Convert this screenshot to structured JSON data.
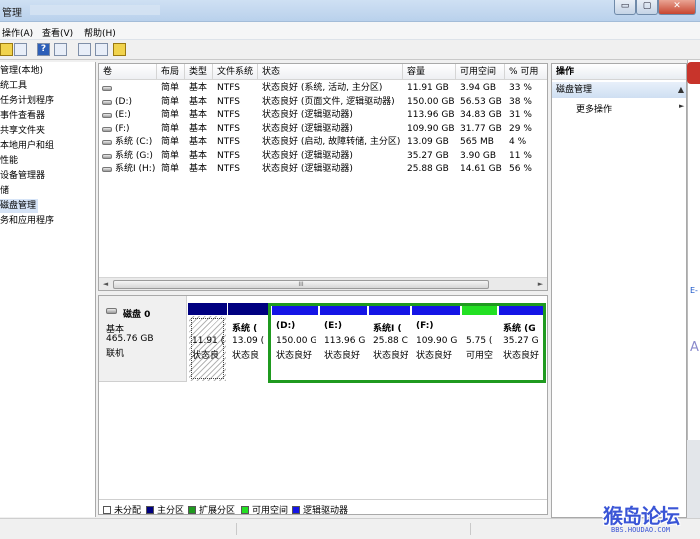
{
  "window": {
    "title": "管理",
    "controls": {
      "minimize": "▭",
      "maximize": "▢",
      "close": "✕"
    }
  },
  "menu": {
    "items": [
      "操作(A)",
      "查看(V)",
      "帮助(H)"
    ]
  },
  "toolbar": {
    "buttons": [
      "folder-icon",
      "console-icon",
      "help-icon",
      "view-icon",
      "export-icon",
      "properties-icon",
      "settings-icon"
    ],
    "help_label": "?"
  },
  "tree": {
    "items": [
      {
        "label": "管理(本地)",
        "selected": false
      },
      {
        "label": "统工具",
        "selected": false
      },
      {
        "label": "任务计划程序",
        "selected": false
      },
      {
        "label": "事件查看器",
        "selected": false
      },
      {
        "label": "共享文件夹",
        "selected": false
      },
      {
        "label": "本地用户和组",
        "selected": false
      },
      {
        "label": "性能",
        "selected": false
      },
      {
        "label": "设备管理器",
        "selected": false
      },
      {
        "label": "储",
        "selected": false
      },
      {
        "label": "磁盘管理",
        "selected": true
      },
      {
        "label": "务和应用程序",
        "selected": false
      }
    ]
  },
  "volumes": {
    "columns": [
      "卷",
      "布局",
      "类型",
      "文件系统",
      "状态",
      "容量",
      "可用空间",
      "% 可用"
    ],
    "rows": [
      [
        "",
        "简单",
        "基本",
        "NTFS",
        "状态良好 (系统, 活动, 主分区)",
        "11.91 GB",
        "3.94 GB",
        "33 %"
      ],
      [
        "(D:)",
        "简单",
        "基本",
        "NTFS",
        "状态良好 (页面文件, 逻辑驱动器)",
        "150.00 GB",
        "56.53 GB",
        "38 %"
      ],
      [
        "(E:)",
        "简单",
        "基本",
        "NTFS",
        "状态良好 (逻辑驱动器)",
        "113.96 GB",
        "34.83 GB",
        "31 %"
      ],
      [
        "(F:)",
        "简单",
        "基本",
        "NTFS",
        "状态良好 (逻辑驱动器)",
        "109.90 GB",
        "31.77 GB",
        "29 %"
      ],
      [
        "系统 (C:)",
        "简单",
        "基本",
        "NTFS",
        "状态良好 (启动, 故障转储, 主分区)",
        "13.09 GB",
        "565 MB",
        "4 %"
      ],
      [
        "系统 (G:)",
        "简单",
        "基本",
        "NTFS",
        "状态良好 (逻辑驱动器)",
        "35.27 GB",
        "3.90 GB",
        "11 %"
      ],
      [
        "系统I (H:)",
        "简单",
        "基本",
        "NTFS",
        "状态良好 (逻辑驱动器)",
        "25.88 GB",
        "14.61 GB",
        "56 %"
      ]
    ],
    "scroll_thumb": "III",
    "scroll_left": "◄",
    "scroll_right": "►"
  },
  "disk": {
    "name": "磁盘 0",
    "type": "基本",
    "size": "465.76 GB",
    "status": "联机",
    "partitions": [
      {
        "line1": "",
        "line2": "11.91 (",
        "line3": "状态良",
        "color": "#000080",
        "hatched": true
      },
      {
        "line1": "系统 (",
        "line2": "13.09 (",
        "line3": "状态良",
        "color": "#000080",
        "hatched": false
      },
      {
        "line1": "(D:)",
        "line2": "150.00 G",
        "line3": "状态良好",
        "color": "#1414e6",
        "hatched": false
      },
      {
        "line1": "(E:)",
        "line2": "113.96 G",
        "line3": "状态良好",
        "color": "#1414e6",
        "hatched": false
      },
      {
        "line1": "系统I (",
        "line2": "25.88 C",
        "line3": "状态良好",
        "color": "#1414e6",
        "hatched": false
      },
      {
        "line1": "(F:)",
        "line2": "109.90 G",
        "line3": "状态良好",
        "color": "#1414e6",
        "hatched": false
      },
      {
        "line1": "",
        "line2": "5.75 (",
        "line3": "可用空",
        "color": "#22e022",
        "hatched": false
      },
      {
        "line1": "系统 (G",
        "line2": "35.27 G",
        "line3": "状态良好",
        "color": "#1414e6",
        "hatched": false
      }
    ]
  },
  "legend": {
    "items": [
      {
        "label": "未分配",
        "color": "#ffffff"
      },
      {
        "label": "主分区",
        "color": "#000080"
      },
      {
        "label": "扩展分区",
        "color": "#1f9a1f"
      },
      {
        "label": "可用空间",
        "color": "#22e022"
      },
      {
        "label": "逻辑驱动器",
        "color": "#1414e6"
      }
    ]
  },
  "actions": {
    "header": "操作",
    "group": "磁盘管理",
    "group_chevron": "▲",
    "more": "更多操作",
    "more_arrow": "►"
  },
  "right_strip": {
    "lines": [
      "E-",
      "A"
    ]
  },
  "watermark": {
    "text": "猴岛论坛",
    "url": "BBS.HOUDAO.COM"
  }
}
